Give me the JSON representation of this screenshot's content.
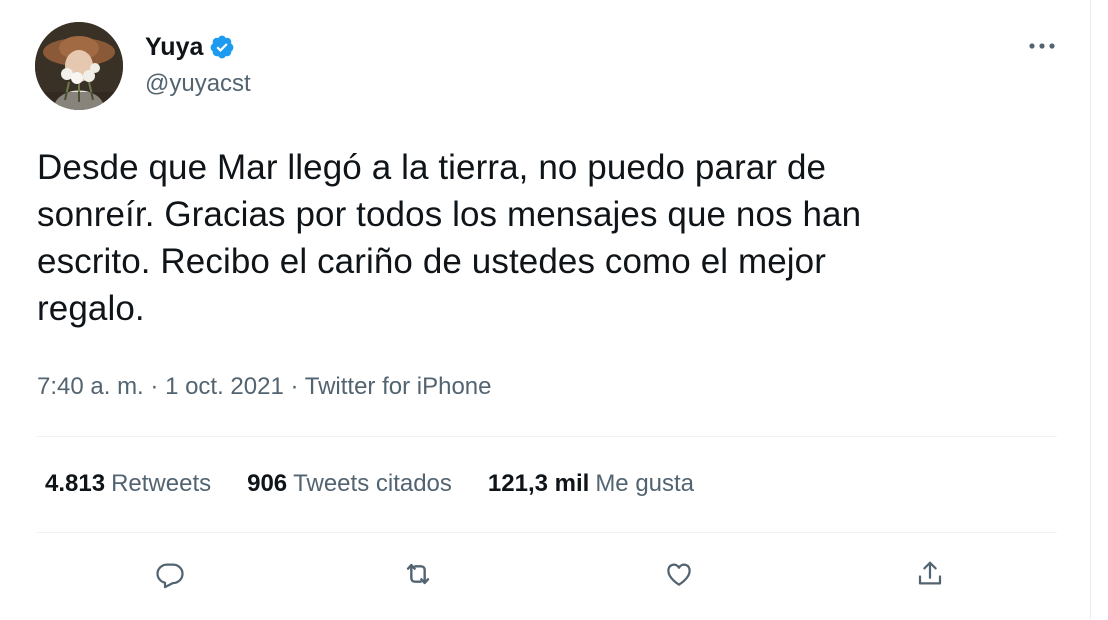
{
  "tweet": {
    "author": {
      "display_name": "Yuya",
      "handle": "@yuyacst",
      "verified": true
    },
    "text": "Desde que Mar llegó a la tierra, no puedo parar de sonreír. Gracias por todos los mensajes que nos han escrito. Recibo el cariño de ustedes como el mejor regalo.",
    "text_lines": [
      "Desde que Mar llegó a la tierra, no puedo parar de",
      "sonreír. Gracias por todos los mensajes que nos han",
      "escrito. Recibo el cariño de ustedes como el mejor",
      "regalo."
    ],
    "time": "7:40 a. m.",
    "date": "1 oct. 2021",
    "separator": " · ",
    "source": "Twitter for iPhone"
  },
  "stats": {
    "retweets": {
      "count": "4.813",
      "label": "Retweets"
    },
    "quotes": {
      "count": "906",
      "label": "Tweets citados"
    },
    "likes": {
      "count": "121,3 mil",
      "label": "Me gusta"
    }
  },
  "actions": [
    "reply-icon",
    "retweet-icon",
    "like-icon",
    "share-icon"
  ],
  "colors": {
    "text": "#0f1419",
    "secondary": "#536471",
    "verified": "#1d9bf0",
    "divider": "#eff3f4"
  }
}
